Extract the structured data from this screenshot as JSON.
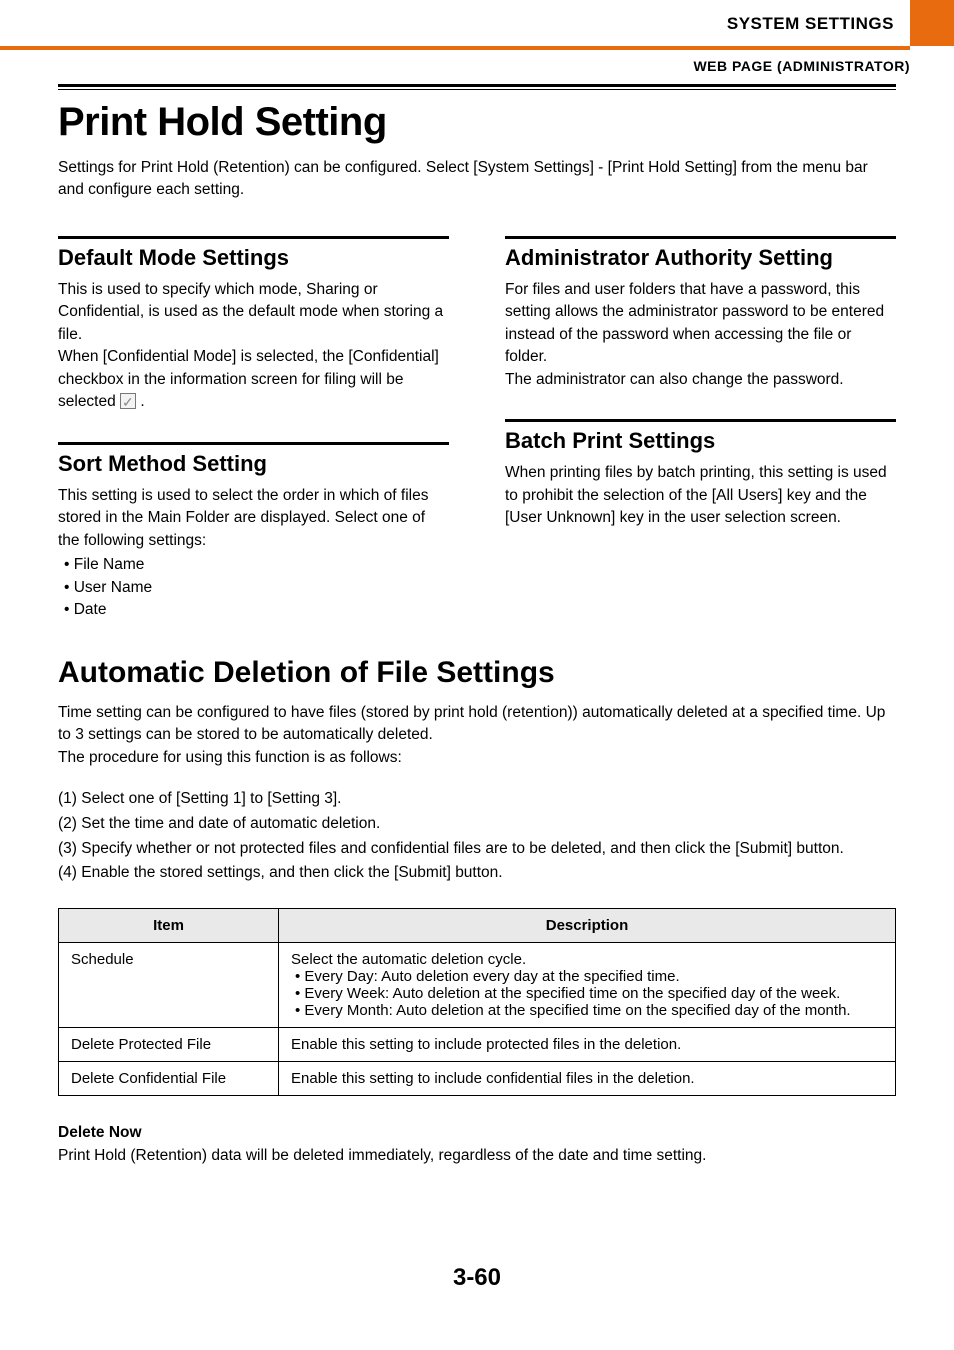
{
  "header": {
    "section": "SYSTEM SETTINGS",
    "sub": "WEB PAGE (ADMINISTRATOR)"
  },
  "title": "Print Hold Setting",
  "intro": "Settings for Print Hold (Retention) can be configured. Select [System Settings] - [Print Hold Setting] from the menu bar and configure each setting.",
  "left": {
    "sec1_title": "Default Mode Settings",
    "sec1_p1": "This is used to specify which mode, Sharing or Confidential, is used as the default mode when storing a file.",
    "sec1_p2a": "When [Confidential Mode] is selected, the [Confidential] checkbox in the information screen for filing will be selected ",
    "sec1_p2b": " .",
    "sec2_title": "Sort Method Setting",
    "sec2_p": "This setting is used to select the order in which of files stored in the Main Folder are displayed. Select one of the following settings:",
    "sec2_items": [
      "File Name",
      "User Name",
      "Date"
    ]
  },
  "right": {
    "sec1_title": "Administrator Authority Setting",
    "sec1_p1": "For files and user folders that have a password, this setting allows the administrator password to be entered instead of the password when accessing the file or folder.",
    "sec1_p2": "The administrator can also change the password.",
    "sec2_title": "Batch Print Settings",
    "sec2_p": "When printing files by batch printing, this setting is used to prohibit the selection of the [All Users] key and the [User Unknown] key in the user selection screen."
  },
  "auto": {
    "title": "Automatic Deletion of File Settings",
    "p1": "Time setting can be configured to have files (stored by print hold (retention)) automatically deleted at a specified time. Up to 3 settings can be stored to be automatically deleted.",
    "p2": "The procedure for using this function is as follows:",
    "steps": [
      "(1)  Select one of [Setting 1] to [Setting 3].",
      "(2)  Set the time and date of automatic deletion.",
      "(3)  Specify whether or not protected files and confidential files are to be deleted, and then click the [Submit] button.",
      "(4)  Enable the stored settings, and then click the [Submit] button."
    ],
    "table": {
      "h_item": "Item",
      "h_desc": "Description",
      "rows": [
        {
          "item": "Schedule",
          "desc_lead": "Select the automatic deletion cycle.",
          "desc_bullets": [
            "Every Day: Auto deletion every day at the specified time.",
            "Every Week: Auto deletion at the specified time on the specified day of the week.",
            "Every Month: Auto deletion at the specified time on the specified day of the month."
          ]
        },
        {
          "item": "Delete Protected File",
          "desc_lead": "Enable this setting to include protected files in the deletion.",
          "desc_bullets": []
        },
        {
          "item": "Delete Confidential File",
          "desc_lead": "Enable this setting to include confidential files in the deletion.",
          "desc_bullets": []
        }
      ]
    },
    "delnow_title": "Delete Now",
    "delnow_body": "Print Hold (Retention) data will be deleted immediately, regardless of the date and time setting."
  },
  "pagenum": "3-60"
}
